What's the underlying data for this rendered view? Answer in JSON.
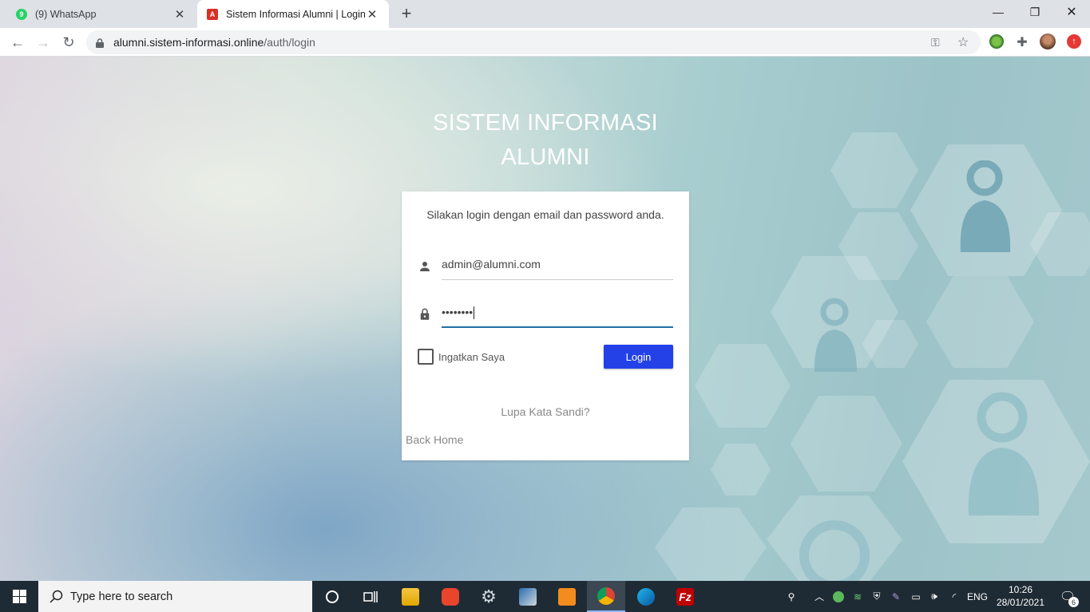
{
  "browser": {
    "tabs": [
      {
        "title": "(9) WhatsApp",
        "favicon_badge": "9",
        "active": false
      },
      {
        "title": "Sistem Informasi Alumni | Login",
        "favicon_badge": "A",
        "active": true
      }
    ],
    "url_host": "alumni.sistem-informasi.online",
    "url_path": "/auth/login"
  },
  "page": {
    "title_line1": "SISTEM INFORMASI",
    "title_line2": "ALUMNI",
    "login_message": "Silakan login dengan email dan password anda.",
    "email_value": "admin@alumni.com",
    "password_mask": "••••••••",
    "remember_label": "Ingatkan Saya",
    "remember_checked": false,
    "login_button": "Login",
    "forgot_link": "Lupa Kata Sandi?",
    "back_link": "Back Home",
    "accent_color": "#2441e8"
  },
  "taskbar": {
    "search_placeholder": "Type here to search",
    "language": "ENG",
    "time": "10:26",
    "date": "28/01/2021",
    "notification_count": "6"
  }
}
